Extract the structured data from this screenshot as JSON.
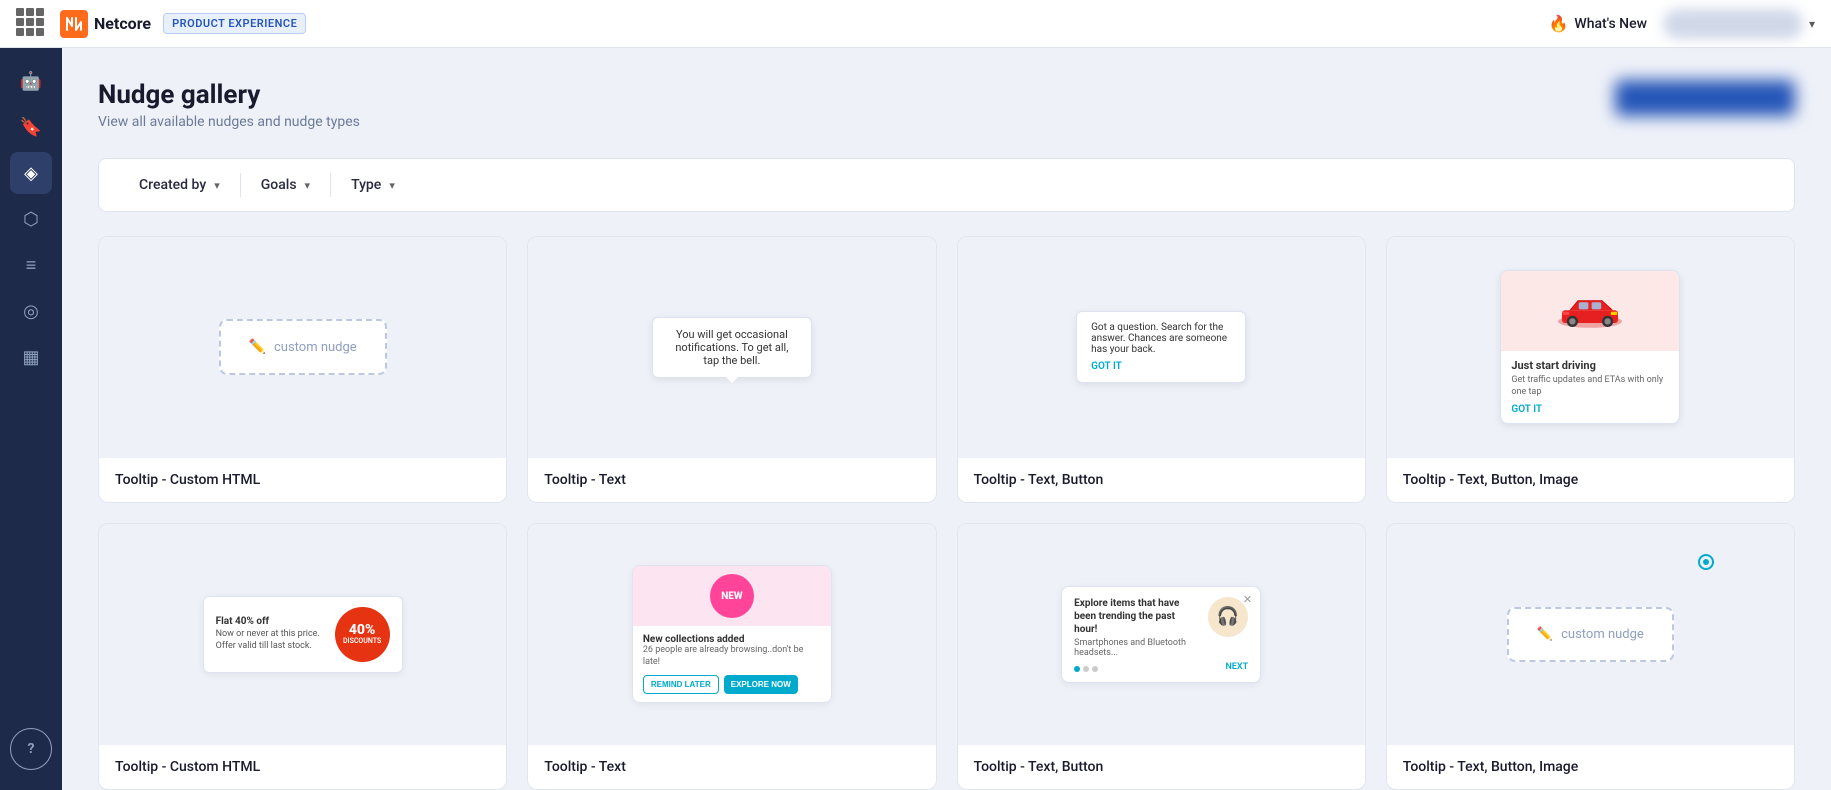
{
  "topNav": {
    "logoText": "Netcore",
    "badge": "PRODUCT EXPERIENCE",
    "whatsNew": "What's New",
    "fireIcon": "🔥"
  },
  "sidebar": {
    "items": [
      {
        "id": "robot",
        "icon": "🤖",
        "active": false
      },
      {
        "id": "bookmark",
        "icon": "🔖",
        "active": false
      },
      {
        "id": "layers",
        "icon": "◈",
        "active": true
      },
      {
        "id": "share",
        "icon": "⬡",
        "active": false
      },
      {
        "id": "list",
        "icon": "≡",
        "active": false
      },
      {
        "id": "target",
        "icon": "◎",
        "active": false
      },
      {
        "id": "grid-sm",
        "icon": "▦",
        "active": false
      },
      {
        "id": "help",
        "icon": "?",
        "active": false
      }
    ]
  },
  "page": {
    "title": "Nudge gallery",
    "subtitle": "View all available nudges and nudge types"
  },
  "filters": {
    "createdBy": "Created by",
    "goals": "Goals",
    "type": "Type"
  },
  "cards": [
    {
      "id": "card-1",
      "label": "Tooltip - Custom HTML",
      "previewType": "custom-html",
      "nudgeText": "custom nudge"
    },
    {
      "id": "card-2",
      "label": "Tooltip - Text",
      "previewType": "tooltip-text",
      "tooltipText": "You will get occasional notifications. To get all, tap the bell."
    },
    {
      "id": "card-3",
      "label": "Tooltip - Text, Button",
      "previewType": "tooltip-text-btn",
      "tooltipText": "Got a question. Search for the answer. Chances are someone has your back.",
      "btnText": "GOT IT"
    },
    {
      "id": "card-4",
      "label": "Tooltip - Text, Button, Image",
      "previewType": "tooltip-text-btn-img",
      "imgAlt": "red car",
      "title": "Just start driving",
      "subtitle": "Get traffic updates and ETAs with only one tap",
      "btnText": "GOT IT"
    },
    {
      "id": "card-5",
      "label": "Tooltip - Custom HTML",
      "previewType": "discount",
      "badgeLabel": "Flat 40% off",
      "badgeText": "Now or never at this price. Offer valid till last stock.",
      "discountPct": "40%",
      "discountSub": "DISCOUNTS"
    },
    {
      "id": "card-6",
      "label": "Tooltip - Text",
      "previewType": "notification-banner",
      "newBadge": "NEW",
      "title": "New collections added",
      "subtitle": "26 people are already browsing..don't be late!",
      "btn1": "REMIND LATER",
      "btn2": "EXPLORE NOW"
    },
    {
      "id": "card-7",
      "label": "Tooltip - Text, Button",
      "previewType": "trending",
      "title": "Explore items that have been trending the past hour!",
      "subtitle": "Smartphones and Bluetooth headsets...",
      "btnText": "NEXT"
    },
    {
      "id": "card-8",
      "label": "Tooltip - Text, Button, Image",
      "previewType": "custom-html-2",
      "nudgeText": "custom nudge"
    }
  ]
}
